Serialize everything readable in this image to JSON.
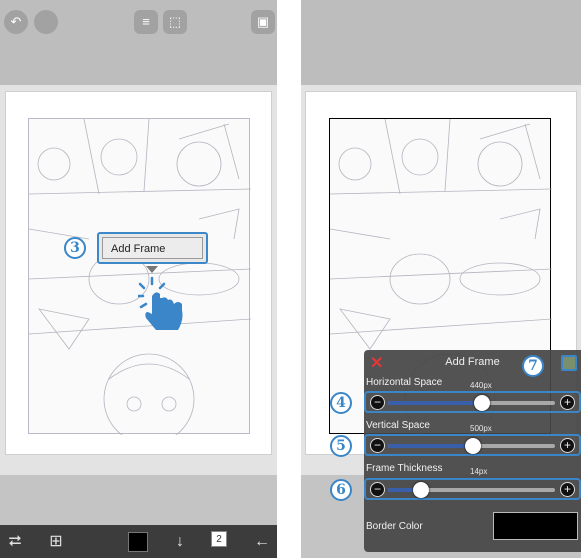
{
  "left_screen": {
    "top_icons": [
      "undo-icon",
      "redo-icon",
      "layer-toggle-icon",
      "selection-icon",
      "image-icon"
    ],
    "context_menu": {
      "item": "Add Frame"
    },
    "step_badge": "3",
    "bottom_toolbar": {
      "icons": [
        "transform-icon",
        "frame-layout-icon",
        "color-swatch",
        "download-arrow-icon",
        "page-icon",
        "back-arrow-icon"
      ],
      "page_number": "2",
      "current_color": "#000000"
    }
  },
  "right_screen": {
    "top_icons": [],
    "add_frame_panel": {
      "title": "Add Frame",
      "close_symbol": "✕",
      "horizontal_space": {
        "label": "Horizontal Space",
        "value": "440px",
        "fraction": 0.56,
        "badge": "4"
      },
      "vertical_space": {
        "label": "Vertical Space",
        "value": "500px",
        "fraction": 0.51,
        "badge": "5"
      },
      "frame_thickness": {
        "label": "Frame Thickness",
        "value": "14px",
        "fraction": 0.2,
        "badge": "6"
      },
      "ok_badge": "7",
      "border_color": {
        "label": "Border Color",
        "value": "#000000"
      },
      "minus_symbol": "−",
      "plus_symbol": "+"
    }
  },
  "colors": {
    "accent_blue": "#3a86c8",
    "panel_bg": "#464646",
    "slider_fill": "#3a5faa",
    "close_red": "#e03838"
  }
}
